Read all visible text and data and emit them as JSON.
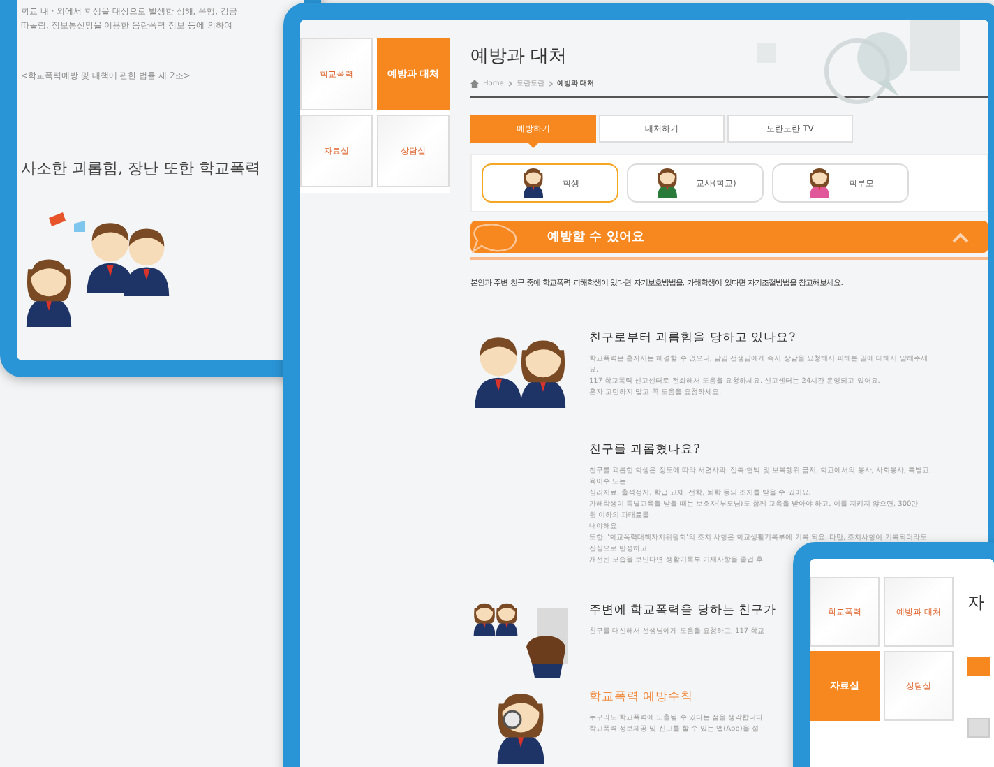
{
  "back_screen": {
    "paragraph_lines": [
      "학교 내 · 외에서 학생을 대상으로 발생한 상해, 폭행, 감금",
      "따돌림, 정보통신망을 이용한 음란폭력 정보 등에 의하여"
    ],
    "law_reference": "<학교폭력예방 및 대책에 관한 법률 제 2조>",
    "headline": "사소한 괴롭힘, 장난 또한 학교폭력"
  },
  "main_screen": {
    "sidebar": [
      {
        "label": "학교폭력",
        "selected": false
      },
      {
        "label": "예방과 대처",
        "selected": true
      },
      {
        "label": "자료실",
        "selected": false
      },
      {
        "label": "상담실",
        "selected": false
      }
    ],
    "title": "예방과 대처",
    "breadcrumb": [
      "Home",
      "도란도란",
      "예방과 대처"
    ],
    "tabs": [
      {
        "label": "예방하기",
        "selected": true
      },
      {
        "label": "대처하기",
        "selected": false
      },
      {
        "label": "도란도란 TV",
        "selected": false
      }
    ],
    "roles": [
      {
        "label": "학생",
        "selected": true
      },
      {
        "label": "교사(학교)",
        "selected": false
      },
      {
        "label": "학부모",
        "selected": false
      }
    ],
    "banner": {
      "title": "예방할 수 있어요",
      "expanded": true
    },
    "intro": "본인과 주변 친구 중에 학교폭력 피해학생이 있다면 자기보호방법을, 가해학생이 있다면 자기조절방법을 참고해보세요.",
    "sections": [
      {
        "kind": "question",
        "heading": "친구로부터 괴롭힘을 당하고 있나요?",
        "lines": [
          "학교폭력은 혼자서는 해결할 수 없으니, 담임 선생님에게 즉시 상담을 요청해서 피해본 일에 대해서 말해주세",
          "요.",
          "117 학교폭력 신고센터로 전화해서 도움을 요청하세요. 신고센터는 24시간 운영되고 있어요.",
          "혼자 고민하지 말고 꼭 도움을 요청하세요."
        ]
      },
      {
        "kind": "question",
        "heading": "친구를 괴롭혔나요?",
        "lines": [
          "친구를 괴롭힌 학생은 정도에 따라 서면사과, 접촉·협박 및 보복행위 금지, 학교에서의 봉사, 사회봉사, 특별교",
          "육이수 또는",
          "심리치료, 출석정지, 학급 교체, 전학, 퇴학 등의 조치를 받을 수 있어요.",
          "가해학생이 특별교육을 받을 때는 보호자(부모님)도 함께 교육을 받아야 하고, 이를 지키지 않으면, 300만",
          "원 이하의 과태료를",
          "내야해요.",
          "또한, '학교폭력대책자치위원회'의 조치 사항은 학교생활기록부에 기록 되요. 다만, 조치사항이 기록되더라도",
          "진심으로 반성하고",
          "개선된 모습을 보인다면 생활기록부 기재사항을 졸업 후"
        ]
      },
      {
        "kind": "question",
        "heading": "주변에 학교폭력을 당하는 친구가",
        "lines": [
          "친구를 대신해서 선생님에게 도움을 요청하고, 117 학교"
        ]
      },
      {
        "kind": "rules",
        "heading": "학교폭력 예방수칙",
        "lines": [
          "누구라도 학교폭력에 노출될 수 있다는 점을 생각합니다",
          "학교폭력 정보제공 및 신고를 할 수 있는 앱(App)을 설"
        ]
      }
    ]
  },
  "front_screen": {
    "sidebar": [
      {
        "label": "학교폭력",
        "selected": false
      },
      {
        "label": "예방과 대처",
        "selected": false
      },
      {
        "label": "자료실",
        "selected": true
      },
      {
        "label": "상담실",
        "selected": false
      }
    ],
    "title": "자"
  }
}
